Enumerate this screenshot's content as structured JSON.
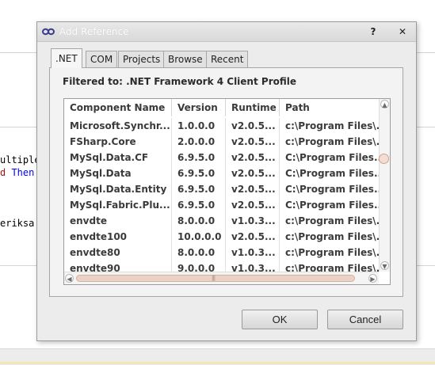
{
  "editor": {
    "lines": [
      {
        "text": "ultiple"
      },
      {
        "prefix": "d ",
        "keyword": "Then"
      },
      {
        "text": "eriksa"
      }
    ]
  },
  "dialog": {
    "title": "Add Reference",
    "help_icon": "question-mark-icon",
    "close_icon": "close-icon",
    "tabs": [
      ".NET",
      "COM",
      "Projects",
      "Browse",
      "Recent"
    ],
    "active_tab": ".NET",
    "filter_text": "Filtered to: .NET Framework 4 Client Profile",
    "columns": [
      "Component Name",
      "Version",
      "Runtime",
      "Path"
    ],
    "rows": [
      [
        "Microsoft.Synchr...",
        "1.0.0.0",
        "v2.0.5...",
        "c:\\Program Files\\..."
      ],
      [
        "FSharp.Core",
        "2.0.0.0",
        "v2.0.5...",
        "c:\\Program Files\\..."
      ],
      [
        "MySql.Data.CF",
        "6.9.5.0",
        "v2.0.5...",
        "C:\\Program Files..."
      ],
      [
        "MySql.Data",
        "6.9.5.0",
        "v2.0.5...",
        "C:\\Program Files..."
      ],
      [
        "MySql.Data.Entity",
        "6.9.5.0",
        "v2.0.5...",
        "C:\\Program Files..."
      ],
      [
        "MySql.Fabric.Plu...",
        "6.9.5.0",
        "v2.0.5...",
        "C:\\Program Files..."
      ],
      [
        "envdte",
        "8.0.0.0",
        "v1.0.3...",
        "c:\\Program Files\\..."
      ],
      [
        "envdte100",
        "10.0.0.0",
        "v2.0.5...",
        "c:\\Program Files\\..."
      ],
      [
        "envdte80",
        "8.0.0.0",
        "v1.0.3...",
        "c:\\Program Files\\..."
      ],
      [
        "envdte90",
        "9.0.0.0",
        "v1.0.3...",
        "c:\\Program Files\\..."
      ]
    ],
    "buttons": {
      "ok": "OK",
      "cancel": "Cancel"
    }
  },
  "colors": {
    "keyword": "#0000ff",
    "string": "#a31515",
    "scroll_thumb": "#ead2c6"
  }
}
